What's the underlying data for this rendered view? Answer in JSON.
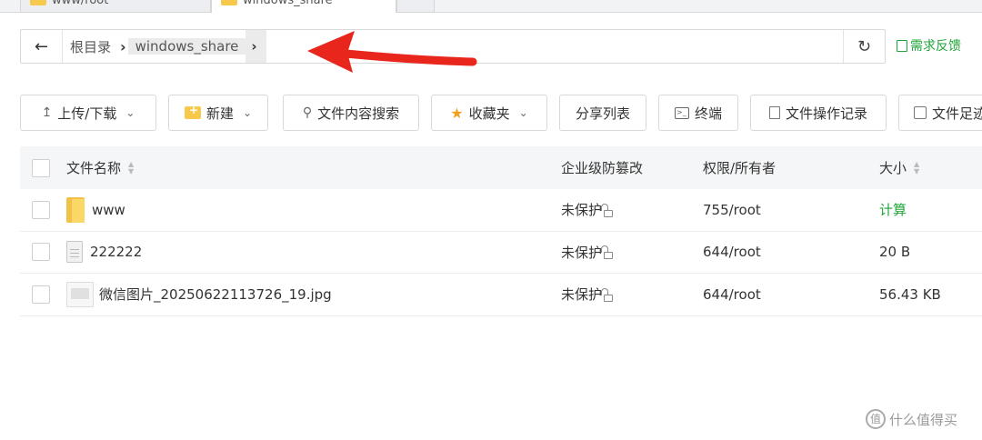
{
  "tabs": [
    {
      "label": "www/root"
    },
    {
      "label": "windows_share"
    },
    {
      "label": ""
    }
  ],
  "address": {
    "crumbs": [
      "根目录",
      "windows_share"
    ],
    "feedback": "需求反馈"
  },
  "toolbar": {
    "upload": "上传/下载",
    "new": "新建",
    "search": "文件内容搜索",
    "favorites": "收藏夹",
    "share_list": "分享列表",
    "terminal": "终端",
    "op_log": "文件操作记录",
    "file_extra": "文件足迹"
  },
  "table": {
    "headers": {
      "name": "文件名称",
      "protect": "企业级防篡改",
      "perm": "权限/所有者",
      "size": "大小"
    },
    "rows": [
      {
        "name": "www",
        "type": "folder",
        "protect": "未保护",
        "perm": "755/root",
        "size": "计算"
      },
      {
        "name": "222222",
        "type": "file",
        "protect": "未保护",
        "perm": "644/root",
        "size": "20 B"
      },
      {
        "name": "微信图片_20250622113726_19.jpg",
        "type": "image",
        "protect": "未保护",
        "perm": "644/root",
        "size": "56.43 KB"
      }
    ]
  },
  "watermark": "值 什么值得买",
  "colors": {
    "accent_green": "#20a53a",
    "arrow_red": "#e8261c",
    "folder_yellow": "#f6c94c"
  }
}
